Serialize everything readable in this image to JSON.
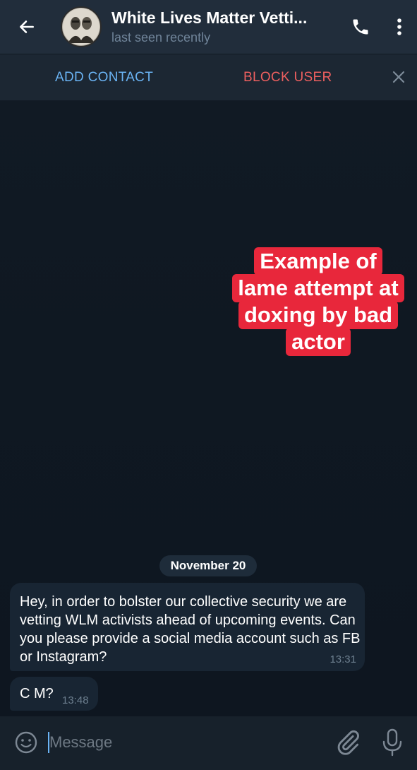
{
  "header": {
    "title": "White Lives Matter Vetti...",
    "status": "last seen recently"
  },
  "actions": {
    "add_contact": "ADD CONTACT",
    "block_user": "BLOCK USER"
  },
  "annotation": {
    "lines": [
      "Example of",
      "lame attempt at",
      "doxing by bad",
      "actor"
    ]
  },
  "chat": {
    "date_separator": "November 20",
    "messages": [
      {
        "text": "Hey, in order to bolster our collective security we are vetting WLM activists ahead of upcoming events. Can you please provide a social media account such as FB or Instagram?",
        "time": "13:31"
      },
      {
        "text": "C M?",
        "time": "13:48"
      }
    ]
  },
  "input": {
    "placeholder": "Message"
  },
  "colors": {
    "accent": "#6ab3f3",
    "danger": "#ec5f5f",
    "annotation_bg": "#e8273b",
    "background": "#0e1621"
  },
  "icons": {
    "back": "arrow-left-icon",
    "call": "phone-icon",
    "menu": "more-vertical-icon",
    "close": "close-icon",
    "emoji": "smile-icon",
    "attach": "paperclip-icon",
    "mic": "microphone-icon"
  }
}
